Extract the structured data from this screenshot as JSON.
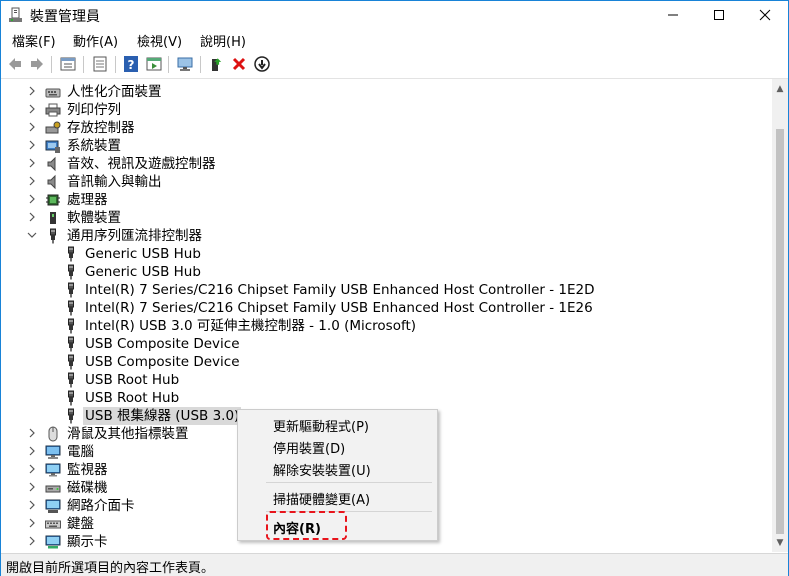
{
  "window": {
    "title": "裝置管理員",
    "buttons": {
      "minimize": "—",
      "maximize": "☐",
      "close": "✕"
    }
  },
  "menubar": {
    "items": [
      "檔案(F)",
      "動作(A)",
      "檢視(V)",
      "說明(H)"
    ]
  },
  "toolbar": {
    "icons": [
      "back-icon",
      "forward-icon",
      "properties-view-icon",
      "properties-icon",
      "help-icon",
      "run-icon",
      "monitor-scan-icon",
      "update-driver-icon",
      "uninstall-icon",
      "disable-icon"
    ]
  },
  "tree": {
    "rows": [
      {
        "label": "人性化介面裝置",
        "level": 1,
        "expand": "collapsed",
        "icon": "hid-icon"
      },
      {
        "label": "列印佇列",
        "level": 1,
        "expand": "collapsed",
        "icon": "printer-icon"
      },
      {
        "label": "存放控制器",
        "level": 1,
        "expand": "collapsed",
        "icon": "storage-controller-icon"
      },
      {
        "label": "系統裝置",
        "level": 1,
        "expand": "collapsed",
        "icon": "system-device-icon"
      },
      {
        "label": "音效、視訊及遊戲控制器",
        "level": 1,
        "expand": "collapsed",
        "icon": "speaker-icon"
      },
      {
        "label": "音訊輸入與輸出",
        "level": 1,
        "expand": "collapsed",
        "icon": "speaker-icon"
      },
      {
        "label": "處理器",
        "level": 1,
        "expand": "collapsed",
        "icon": "processor-icon"
      },
      {
        "label": "軟體裝置",
        "level": 1,
        "expand": "collapsed",
        "icon": "software-device-icon"
      },
      {
        "label": "通用序列匯流排控制器",
        "level": 1,
        "expand": "expanded",
        "icon": "usb-icon"
      },
      {
        "label": "Generic USB Hub",
        "level": 2,
        "expand": "none",
        "icon": "usb-icon"
      },
      {
        "label": "Generic USB Hub",
        "level": 2,
        "expand": "none",
        "icon": "usb-icon"
      },
      {
        "label": "Intel(R) 7 Series/C216 Chipset Family USB Enhanced Host Controller - 1E2D",
        "level": 2,
        "expand": "none",
        "icon": "usb-icon"
      },
      {
        "label": "Intel(R) 7 Series/C216 Chipset Family USB Enhanced Host Controller - 1E26",
        "level": 2,
        "expand": "none",
        "icon": "usb-icon"
      },
      {
        "label": "Intel(R) USB 3.0 可延伸主機控制器 - 1.0 (Microsoft)",
        "level": 2,
        "expand": "none",
        "icon": "usb-icon"
      },
      {
        "label": "USB Composite Device",
        "level": 2,
        "expand": "none",
        "icon": "usb-icon"
      },
      {
        "label": "USB Composite Device",
        "level": 2,
        "expand": "none",
        "icon": "usb-icon"
      },
      {
        "label": "USB Root Hub",
        "level": 2,
        "expand": "none",
        "icon": "usb-icon"
      },
      {
        "label": "USB Root Hub",
        "level": 2,
        "expand": "none",
        "icon": "usb-icon"
      },
      {
        "label": "USB 根集線器 (USB 3.0)",
        "level": 2,
        "expand": "none",
        "icon": "usb-icon",
        "selected": true
      },
      {
        "label": "滑鼠及其他指標裝置",
        "level": 1,
        "expand": "collapsed",
        "icon": "mouse-icon"
      },
      {
        "label": "電腦",
        "level": 1,
        "expand": "collapsed",
        "icon": "computer-icon"
      },
      {
        "label": "監視器",
        "level": 1,
        "expand": "collapsed",
        "icon": "monitor-icon"
      },
      {
        "label": "磁碟機",
        "level": 1,
        "expand": "collapsed",
        "icon": "disk-drive-icon"
      },
      {
        "label": "網路介面卡",
        "level": 1,
        "expand": "collapsed",
        "icon": "network-adapter-icon"
      },
      {
        "label": "鍵盤",
        "level": 1,
        "expand": "collapsed",
        "icon": "keyboard-icon"
      },
      {
        "label": "顯示卡",
        "level": 1,
        "expand": "collapsed",
        "icon": "display-adapter-icon"
      }
    ]
  },
  "context_menu": {
    "update_driver": "更新驅動程式(P)",
    "disable_device": "停用裝置(D)",
    "uninstall_device": "解除安裝裝置(U)",
    "scan_hardware": "掃描硬體變更(A)",
    "properties": "內容(R)"
  },
  "statusbar": {
    "text": "開啟目前所選項目的內容工作表頁。"
  },
  "colors": {
    "accent_border": "#1883d7",
    "highlight_dash": "#e8141c",
    "selection": "#d9d9d9"
  }
}
